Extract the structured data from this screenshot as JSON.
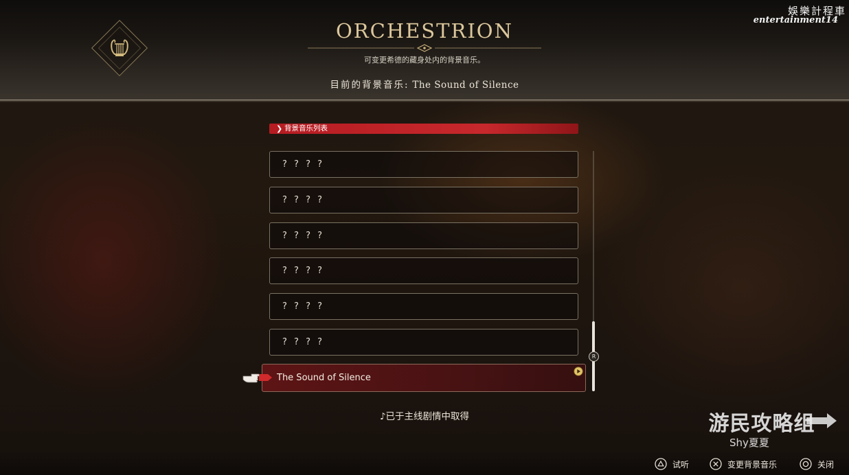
{
  "header": {
    "title": "ORCHESTRION",
    "subtitle": "可变更希德的藏身处内的背景音乐。",
    "current_bgm_label": "目前的背景音乐:",
    "current_bgm_value": "The Sound of Silence",
    "emblem_icon": "lyre-icon"
  },
  "watermark_top": {
    "line1": "娛樂計程車",
    "line2": "entertainment14"
  },
  "list": {
    "header_label": "背景音乐列表",
    "items": [
      {
        "label": "? ? ? ?",
        "selected": false
      },
      {
        "label": "? ? ? ?",
        "selected": false
      },
      {
        "label": "? ? ? ?",
        "selected": false
      },
      {
        "label": "? ? ? ?",
        "selected": false
      },
      {
        "label": "? ? ? ?",
        "selected": false
      },
      {
        "label": "? ? ? ?",
        "selected": false
      },
      {
        "label": "The Sound of Silence",
        "selected": true
      }
    ],
    "scroll_badge": "R"
  },
  "acquisition_note": "♪已于主线剧情中取得",
  "watermark_bottom": {
    "line1": "游民攻略组",
    "line2": "Shy夏夏"
  },
  "footer": {
    "buttons": [
      {
        "icon": "triangle-button-icon",
        "label": "试听"
      },
      {
        "icon": "cross-button-icon",
        "label": "变更背景音乐"
      },
      {
        "icon": "circle-button-icon",
        "label": "关闭"
      }
    ]
  },
  "colors": {
    "accent_red": "#c7282c",
    "title_gold": "#dcc79c",
    "selected_bg": "#691416"
  }
}
